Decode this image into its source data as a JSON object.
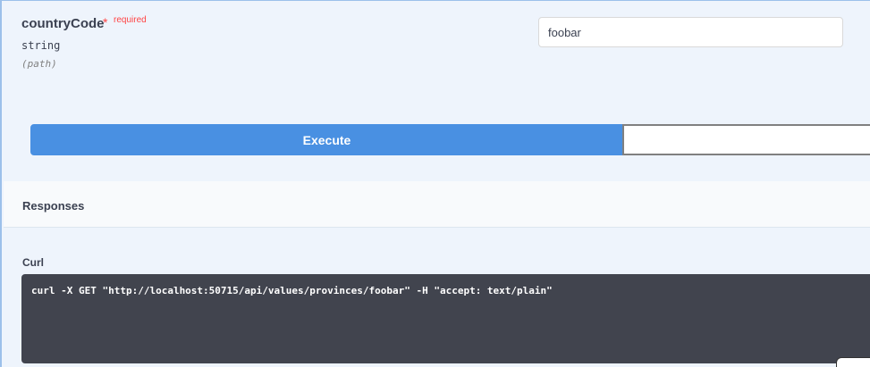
{
  "parameter": {
    "name": "countryCode",
    "required_star": "*",
    "required_label": "required",
    "type": "string",
    "in": "(path)",
    "value": "foobar"
  },
  "actions": {
    "execute_label": "Execute",
    "clear_label": ""
  },
  "responses": {
    "title": "Responses"
  },
  "curl": {
    "label": "Curl",
    "command": "curl -X GET \"http://localhost:50715/api/values/provinces/foobar\" -H \"accept: text/plain\""
  },
  "colors": {
    "execute_bg": "#4990e2",
    "block_bg": "#eef4fc",
    "curl_bg": "#41444e",
    "required": "#ff4444"
  }
}
